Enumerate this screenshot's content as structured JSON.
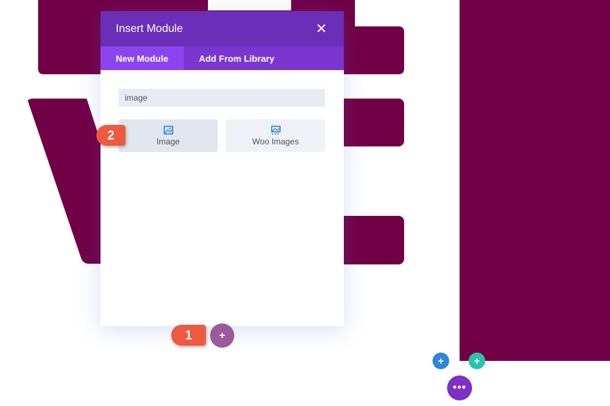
{
  "modal": {
    "title": "Insert Module",
    "close_icon": "close-icon",
    "tabs": [
      {
        "label": "New Module",
        "active": true
      },
      {
        "label": "Add From Library",
        "active": false
      }
    ],
    "search_value": "image",
    "results": [
      {
        "label": "Image",
        "icon": "image-icon"
      },
      {
        "label": "Woo Images",
        "icon": "woo-images-icon"
      }
    ]
  },
  "annotations": [
    {
      "label": "1"
    },
    {
      "label": "2"
    }
  ],
  "colors": {
    "header": "#6b2eb8",
    "tab_active": "#8c44f0",
    "background_shape": "#720046",
    "callout": "#ee5a3f",
    "add_module": "#9b5a9b",
    "add_row": "#2b87da",
    "add_column": "#29c4a9",
    "menu": "#7e2fc4"
  },
  "controls": {
    "add_module_icon": "plus-icon",
    "add_row_icon": "plus-icon",
    "add_column_icon": "plus-icon",
    "menu_icon": "ellipsis-icon"
  }
}
